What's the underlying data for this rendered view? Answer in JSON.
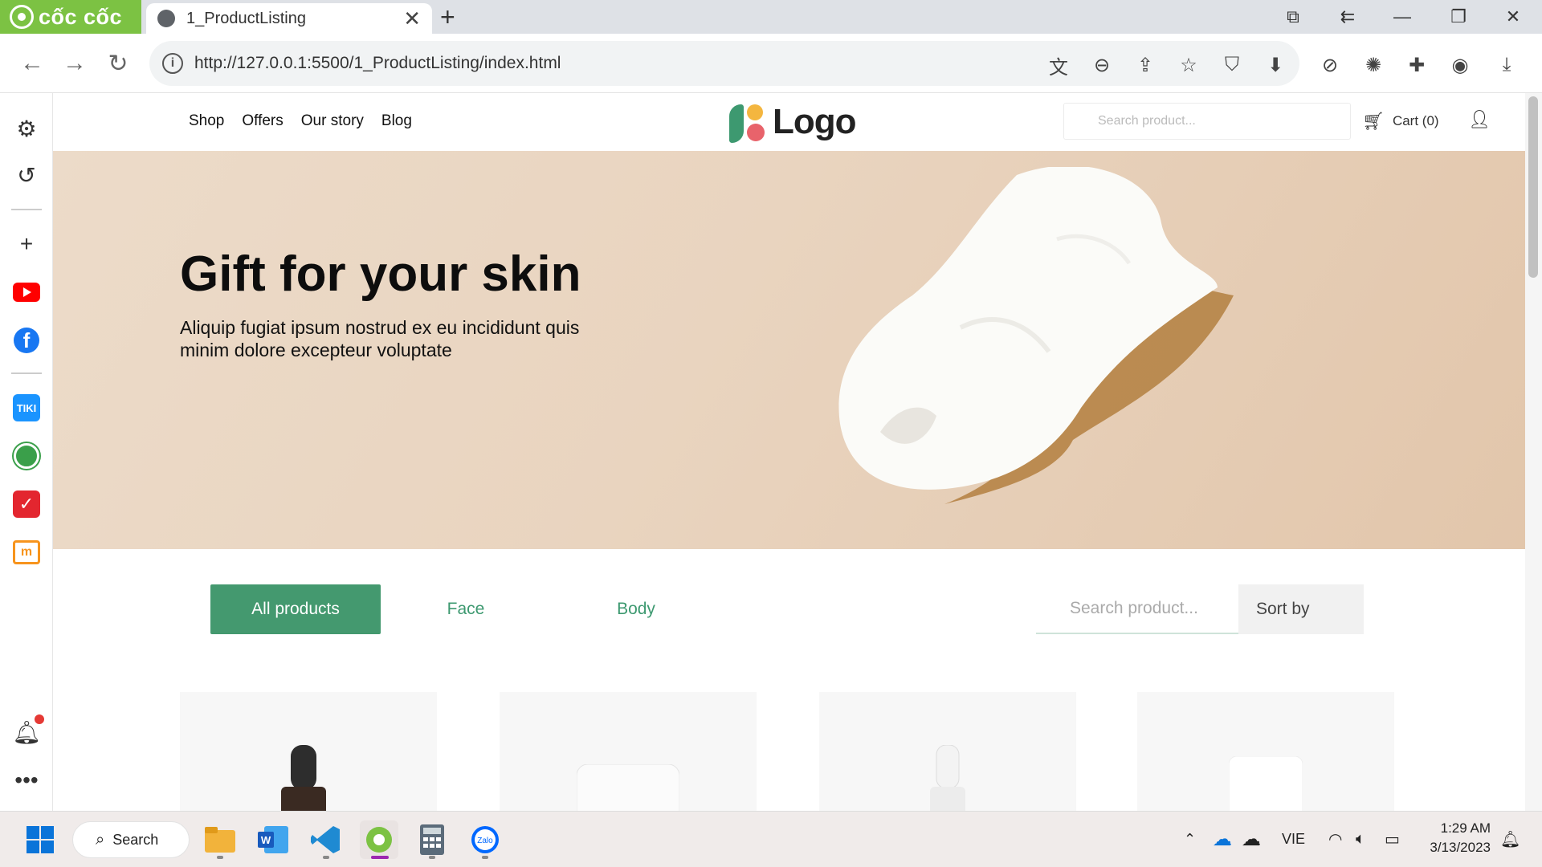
{
  "browser": {
    "brand": "cốc cốc",
    "tab_title": "1_ProductListing",
    "url": "http://127.0.0.1:5500/1_ProductListing/index.html"
  },
  "site": {
    "nav": [
      "Shop",
      "Offers",
      "Our story",
      "Blog"
    ],
    "logo_text": "Logo",
    "search_placeholder": "Search product...",
    "cart_label": "Cart (0)",
    "hero_title": "Gift for your skin",
    "hero_subtitle": "Aliquip fugiat ipsum nostrud ex eu incididunt quis minim dolore excepteur voluptate",
    "filters": [
      "All products",
      "Face",
      "Body"
    ],
    "filter_search_placeholder": "Search product...",
    "sort_label": "Sort by",
    "accent_color": "#44996f"
  },
  "taskbar": {
    "search_label": "Search",
    "language": "VIE",
    "time": "1:29 AM",
    "date": "3/13/2023"
  }
}
